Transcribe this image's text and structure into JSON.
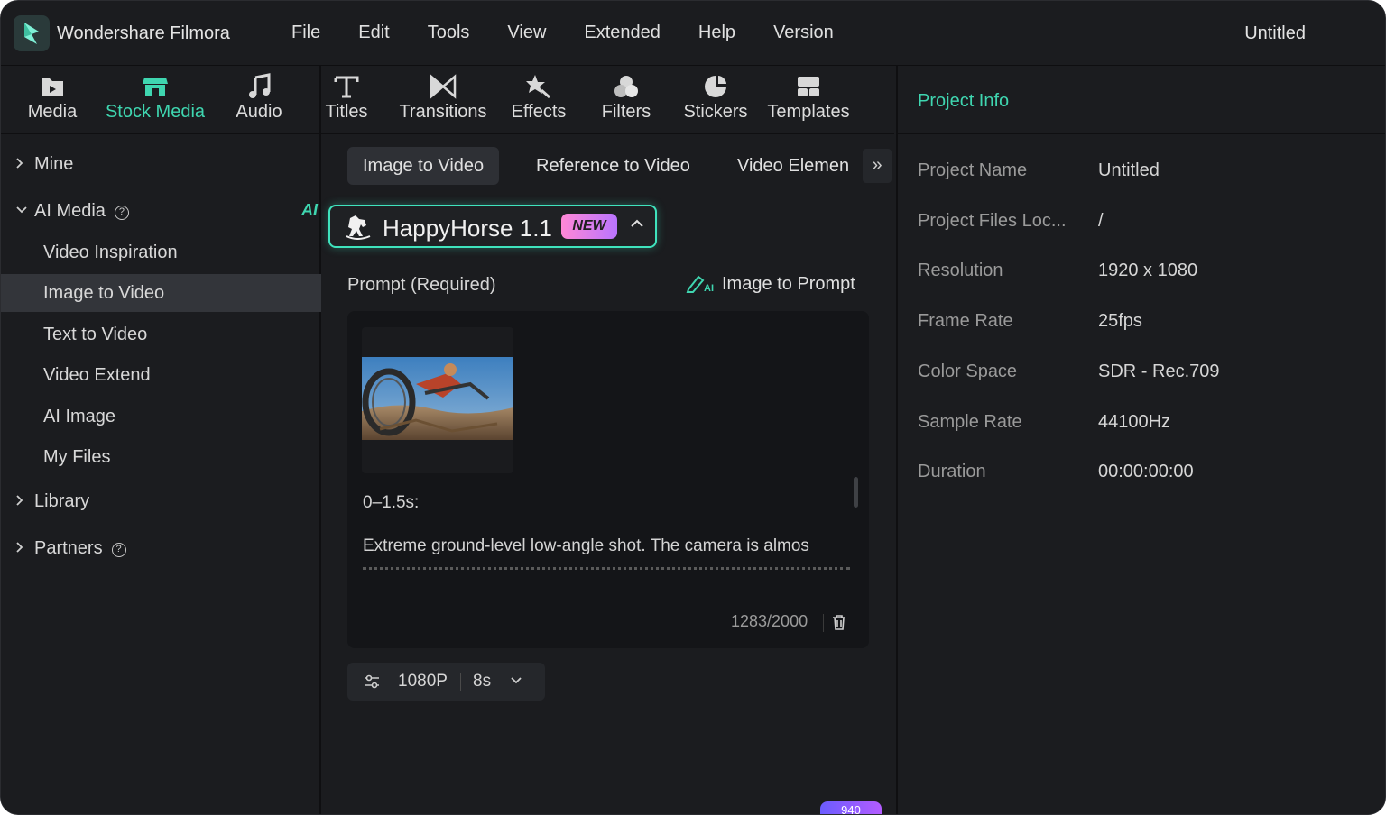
{
  "app": {
    "name": "Wondershare Filmora",
    "document_title": "Untitled"
  },
  "menu": [
    "File",
    "Edit",
    "Tools",
    "View",
    "Extended",
    "Help",
    "Version"
  ],
  "toolbar": {
    "active": "Stock Media",
    "items": [
      "Media",
      "Stock Media",
      "Audio",
      "Titles",
      "Transitions",
      "Effects",
      "Filters",
      "Stickers",
      "Templates"
    ]
  },
  "sidebar": {
    "mine": "Mine",
    "ai_media": "AI Media",
    "ai_tag": "AI",
    "children": [
      "Video Inspiration",
      "Image to Video",
      "Text to Video",
      "Video Extend",
      "AI Image",
      "My Files"
    ],
    "selected": "Image to Video",
    "library": "Library",
    "partners": "Partners",
    "help_glyph": "?"
  },
  "center": {
    "tabs": [
      "Image to Video",
      "Reference to Video",
      "Video Elemen"
    ],
    "active_tab": "Image to Video",
    "more": "»",
    "model": {
      "name": "HappyHorse 1.1",
      "badge": "NEW"
    },
    "prompt_label": "Prompt (Required)",
    "image_to_prompt": "Image to Prompt",
    "prompt_line1": "0–1.5s:",
    "prompt_line2": "Extreme ground-level low-angle shot. The camera is almos",
    "counter": "1283/2000",
    "resolution": "1080P",
    "duration": "8s",
    "credit": "940"
  },
  "project_info": {
    "title": "Project Info",
    "rows": [
      {
        "key": "Project Name",
        "value": "Untitled"
      },
      {
        "key": "Project Files Loc...",
        "value": "/"
      },
      {
        "key": "Resolution",
        "value": "1920 x 1080"
      },
      {
        "key": "Frame Rate",
        "value": "25fps"
      },
      {
        "key": "Color Space",
        "value": "SDR - Rec.709"
      },
      {
        "key": "Sample Rate",
        "value": "44100Hz"
      },
      {
        "key": "Duration",
        "value": "00:00:00:00"
      }
    ]
  },
  "colors": {
    "accent": "#3fd6b0",
    "background": "#1b1c1f",
    "badge_gradient_start": "#ff88d6",
    "badge_gradient_end": "#b974ff"
  },
  "icons": [
    "filmora-logo-icon",
    "media-folder-icon",
    "stock-store-icon",
    "music-note-icon",
    "title-t-icon",
    "transition-bowtie-icon",
    "effects-star-icon",
    "filters-circles-icon",
    "stickers-icon",
    "templates-icon",
    "chevron-right-icon",
    "chevron-down-icon",
    "help-icon",
    "horse-icon",
    "chevron-up-icon",
    "image-to-prompt-icon",
    "trash-icon",
    "sliders-icon"
  ]
}
